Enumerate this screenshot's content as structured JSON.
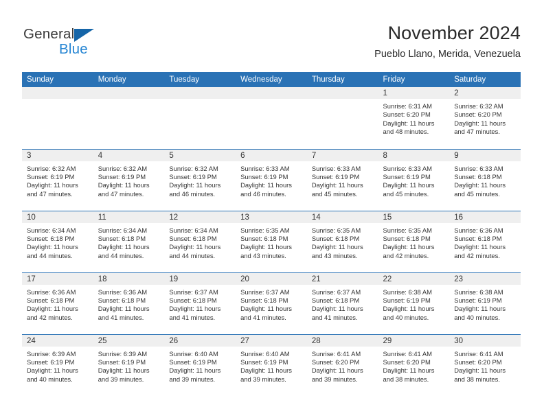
{
  "brand": {
    "name_part1": "General",
    "name_part2": "Blue",
    "accent_color": "#2585d3",
    "triangle_color": "#1565a8"
  },
  "header": {
    "title": "November 2024",
    "subtitle": "Pueblo Llano, Merida, Venezuela"
  },
  "theme": {
    "header_blue": "#2a72b5",
    "daynum_gray": "#efefef",
    "text_color": "#333333"
  },
  "weekday_headers": [
    "Sunday",
    "Monday",
    "Tuesday",
    "Wednesday",
    "Thursday",
    "Friday",
    "Saturday"
  ],
  "labels": {
    "sunrise_prefix": "Sunrise: ",
    "sunset_prefix": "Sunset: ",
    "daylight_prefix": "Daylight: "
  },
  "weeks": [
    [
      {
        "day": "",
        "empty": true
      },
      {
        "day": "",
        "empty": true
      },
      {
        "day": "",
        "empty": true
      },
      {
        "day": "",
        "empty": true
      },
      {
        "day": "",
        "empty": true
      },
      {
        "day": "1",
        "sunrise": "Sunrise: 6:31 AM",
        "sunset": "Sunset: 6:20 PM",
        "daylight": "Daylight: 11 hours and 48 minutes."
      },
      {
        "day": "2",
        "sunrise": "Sunrise: 6:32 AM",
        "sunset": "Sunset: 6:20 PM",
        "daylight": "Daylight: 11 hours and 47 minutes."
      }
    ],
    [
      {
        "day": "3",
        "sunrise": "Sunrise: 6:32 AM",
        "sunset": "Sunset: 6:19 PM",
        "daylight": "Daylight: 11 hours and 47 minutes."
      },
      {
        "day": "4",
        "sunrise": "Sunrise: 6:32 AM",
        "sunset": "Sunset: 6:19 PM",
        "daylight": "Daylight: 11 hours and 47 minutes."
      },
      {
        "day": "5",
        "sunrise": "Sunrise: 6:32 AM",
        "sunset": "Sunset: 6:19 PM",
        "daylight": "Daylight: 11 hours and 46 minutes."
      },
      {
        "day": "6",
        "sunrise": "Sunrise: 6:33 AM",
        "sunset": "Sunset: 6:19 PM",
        "daylight": "Daylight: 11 hours and 46 minutes."
      },
      {
        "day": "7",
        "sunrise": "Sunrise: 6:33 AM",
        "sunset": "Sunset: 6:19 PM",
        "daylight": "Daylight: 11 hours and 45 minutes."
      },
      {
        "day": "8",
        "sunrise": "Sunrise: 6:33 AM",
        "sunset": "Sunset: 6:19 PM",
        "daylight": "Daylight: 11 hours and 45 minutes."
      },
      {
        "day": "9",
        "sunrise": "Sunrise: 6:33 AM",
        "sunset": "Sunset: 6:18 PM",
        "daylight": "Daylight: 11 hours and 45 minutes."
      }
    ],
    [
      {
        "day": "10",
        "sunrise": "Sunrise: 6:34 AM",
        "sunset": "Sunset: 6:18 PM",
        "daylight": "Daylight: 11 hours and 44 minutes."
      },
      {
        "day": "11",
        "sunrise": "Sunrise: 6:34 AM",
        "sunset": "Sunset: 6:18 PM",
        "daylight": "Daylight: 11 hours and 44 minutes."
      },
      {
        "day": "12",
        "sunrise": "Sunrise: 6:34 AM",
        "sunset": "Sunset: 6:18 PM",
        "daylight": "Daylight: 11 hours and 44 minutes."
      },
      {
        "day": "13",
        "sunrise": "Sunrise: 6:35 AM",
        "sunset": "Sunset: 6:18 PM",
        "daylight": "Daylight: 11 hours and 43 minutes."
      },
      {
        "day": "14",
        "sunrise": "Sunrise: 6:35 AM",
        "sunset": "Sunset: 6:18 PM",
        "daylight": "Daylight: 11 hours and 43 minutes."
      },
      {
        "day": "15",
        "sunrise": "Sunrise: 6:35 AM",
        "sunset": "Sunset: 6:18 PM",
        "daylight": "Daylight: 11 hours and 42 minutes."
      },
      {
        "day": "16",
        "sunrise": "Sunrise: 6:36 AM",
        "sunset": "Sunset: 6:18 PM",
        "daylight": "Daylight: 11 hours and 42 minutes."
      }
    ],
    [
      {
        "day": "17",
        "sunrise": "Sunrise: 6:36 AM",
        "sunset": "Sunset: 6:18 PM",
        "daylight": "Daylight: 11 hours and 42 minutes."
      },
      {
        "day": "18",
        "sunrise": "Sunrise: 6:36 AM",
        "sunset": "Sunset: 6:18 PM",
        "daylight": "Daylight: 11 hours and 41 minutes."
      },
      {
        "day": "19",
        "sunrise": "Sunrise: 6:37 AM",
        "sunset": "Sunset: 6:18 PM",
        "daylight": "Daylight: 11 hours and 41 minutes."
      },
      {
        "day": "20",
        "sunrise": "Sunrise: 6:37 AM",
        "sunset": "Sunset: 6:18 PM",
        "daylight": "Daylight: 11 hours and 41 minutes."
      },
      {
        "day": "21",
        "sunrise": "Sunrise: 6:37 AM",
        "sunset": "Sunset: 6:18 PM",
        "daylight": "Daylight: 11 hours and 41 minutes."
      },
      {
        "day": "22",
        "sunrise": "Sunrise: 6:38 AM",
        "sunset": "Sunset: 6:19 PM",
        "daylight": "Daylight: 11 hours and 40 minutes."
      },
      {
        "day": "23",
        "sunrise": "Sunrise: 6:38 AM",
        "sunset": "Sunset: 6:19 PM",
        "daylight": "Daylight: 11 hours and 40 minutes."
      }
    ],
    [
      {
        "day": "24",
        "sunrise": "Sunrise: 6:39 AM",
        "sunset": "Sunset: 6:19 PM",
        "daylight": "Daylight: 11 hours and 40 minutes."
      },
      {
        "day": "25",
        "sunrise": "Sunrise: 6:39 AM",
        "sunset": "Sunset: 6:19 PM",
        "daylight": "Daylight: 11 hours and 39 minutes."
      },
      {
        "day": "26",
        "sunrise": "Sunrise: 6:40 AM",
        "sunset": "Sunset: 6:19 PM",
        "daylight": "Daylight: 11 hours and 39 minutes."
      },
      {
        "day": "27",
        "sunrise": "Sunrise: 6:40 AM",
        "sunset": "Sunset: 6:19 PM",
        "daylight": "Daylight: 11 hours and 39 minutes."
      },
      {
        "day": "28",
        "sunrise": "Sunrise: 6:41 AM",
        "sunset": "Sunset: 6:20 PM",
        "daylight": "Daylight: 11 hours and 39 minutes."
      },
      {
        "day": "29",
        "sunrise": "Sunrise: 6:41 AM",
        "sunset": "Sunset: 6:20 PM",
        "daylight": "Daylight: 11 hours and 38 minutes."
      },
      {
        "day": "30",
        "sunrise": "Sunrise: 6:41 AM",
        "sunset": "Sunset: 6:20 PM",
        "daylight": "Daylight: 11 hours and 38 minutes."
      }
    ]
  ]
}
